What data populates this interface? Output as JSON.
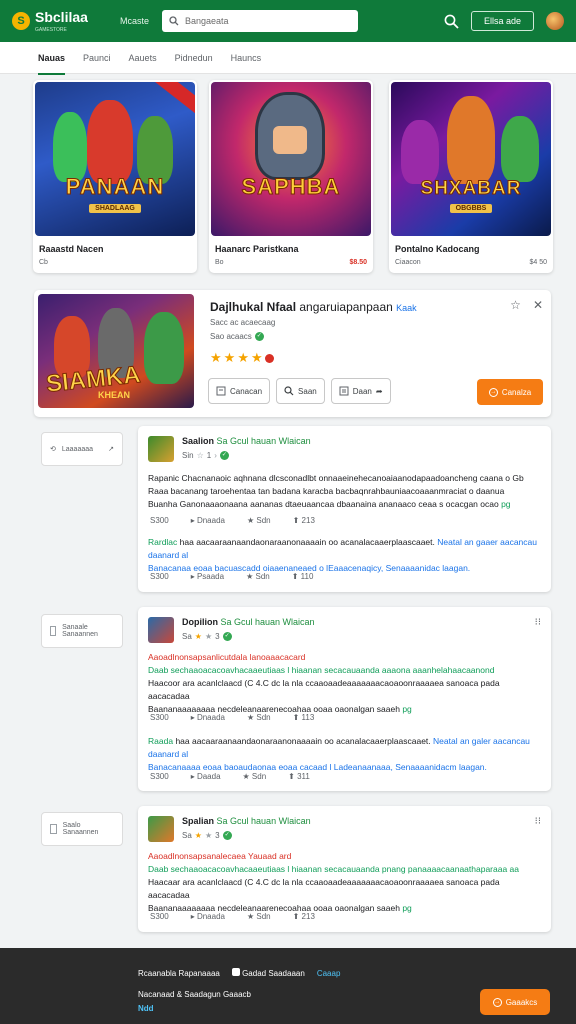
{
  "header": {
    "logo_text": "Sbclilaa",
    "logo_sub": "GAMESTORE",
    "nav_link": "Mcaste",
    "search_placeholder": "Bangaeata",
    "signin_label": "Ellsa ade"
  },
  "tabs": [
    {
      "label": "Nauas",
      "active": true
    },
    {
      "label": "Paunci"
    },
    {
      "label": "Aauets"
    },
    {
      "label": "Pidnedun"
    },
    {
      "label": "Hauncs"
    }
  ],
  "cards": [
    {
      "art_title": "PANAAN",
      "art_sub": "SHADLAAG",
      "name": "Raaastd Nacen",
      "meta_left": "Cb",
      "meta_right": ""
    },
    {
      "art_title": "SAPHBA",
      "art_sub": "",
      "name": "Haanarc Paristkana",
      "meta_left": "Bo",
      "meta_right": "$8.50"
    },
    {
      "art_title": "SHXABAR",
      "art_sub": "OBGBBS",
      "name": "Pontalno Kadocang",
      "meta_left": "Ciaacon",
      "meta_right": "$4 50"
    }
  ],
  "detail": {
    "art_title": "SIAMKA",
    "art_sub": "KHEAN",
    "title": "Dajlhukal Nfaal",
    "title_rest": "angaruiapanpaan",
    "tag": "Kaak",
    "sub1": "Sacc ac acaecaag",
    "sub2": "Sao acaacs",
    "rating": 4,
    "btn1": "Canacan",
    "btn2": "Saan",
    "btn3": "Daan",
    "install_label": "Canalza"
  },
  "side_chips": [
    {
      "label": "Laaaaaaa"
    },
    {
      "label": "Sanaale Sanaannen"
    },
    {
      "label": "Saalo Sanaannen"
    }
  ],
  "reviews": [
    {
      "name": "Saalion",
      "name_sub": "Sa Gcul hauan Wlaican",
      "rating_label": "Sin",
      "rating_count": "1",
      "body": [
        "Rapanic Chacnanaoic aqhnana dlcsconadlbt onnaaeinehecanoaiaanodapaadoancheng caana o Gb",
        "Raaa bacanang taroehentaa tan badana karacba bacbaqnrahbauniaacoaaanmraciat o daanua",
        "Buanha Ganonaaaonaana aananas dtaeuaancaa dbaanaina ananaaco ceaa s ocacgan ocao"
      ],
      "body_tail": "pg",
      "foot": {
        "a": "S300",
        "b": "Dnaada",
        "c": "Sdn",
        "d": "213"
      },
      "reply_1a": "Rardlac",
      "reply_1b": "haa aacaaraanaandaonaraanonaaaain oo acanalacaaerplaascaaet.",
      "reply_1c": "Neatal an gaaer aacancau daanard al",
      "reply_2": "Banacanaa eoaa bacuascadd oiaaenaneaed o lEaaacenaqicy, Senaaaanidac laagan.",
      "foot2": {
        "a": "S300",
        "b": "Psaada",
        "c": "Sdn",
        "d": "110"
      }
    },
    {
      "name": "Dopilion",
      "name_sub": "Sa Gcul hauan Wlaican",
      "rating_label": "Sa",
      "rating_count": "3",
      "body": [
        "Aaoadlnonsapsanlicutdala lanoaaacacard",
        "Daab sechaaoacacoavhacaaeutiaas l hiaanan secacauaanda aaaona aaanhelahaacaanond",
        "Haacoor ara acanlclaacd (C 4.C dc la nla ccaaoaadeaaaaaaacaoaoonraaaaea sanoaca pada aacacadaa",
        "Baananaaaaaaaa necdeleanaarenecoahaa ooaa oaonalgan saaeh"
      ],
      "body_tail": "pg",
      "foot": {
        "a": "S300",
        "b": "Dnaada",
        "c": "Sdn",
        "d": "113"
      },
      "reply_1a": "Raada",
      "reply_1b": "haa aacaaraanaandaonaraanonaaaain oo acanalacaaerplaascaaet.",
      "reply_1c": "Neatal an galer aacancau daanard al",
      "reply_2": "Banacanaaaa eoaa baoaudaonaa eoaa cacaad l Ladeanaanaaa, Senaaaanidacm laagan.",
      "foot2": {
        "a": "S300",
        "b": "Daada",
        "c": "Sdn",
        "d": "311"
      }
    },
    {
      "name": "Spalian",
      "name_sub": "Sa Gcul hauan Wlaican",
      "rating_label": "Sa",
      "rating_count": "3",
      "body": [
        "Aaoadlnonsapsanalecaea Yauaad ard",
        "Daab sechaaoacacoavhacaaeutiaas l hiaanan secacauaanda pnang panaaaacaanaathaparaaa aa",
        "Haacaar ara acanlclaacd (C 4.C dc la nla ccaaoaadeaaaaaaacaoaoonraaaaea sanoaca pada aacacadaa",
        "Baananaaaaaaaa necdeleanaarenecoahaa ooaa oaonalgan saaeh"
      ],
      "body_tail": "pg",
      "foot": {
        "a": "S300",
        "b": "Dnaada",
        "c": "Sdn",
        "d": "213"
      }
    }
  ],
  "footer": {
    "link1": "Rcaanabla Rapanaaaa",
    "link2": "Gadad Saadaaan",
    "link3": "Caaap",
    "line2": "Nacanaad & Saadagun Gaaacb",
    "line3": "Ndd",
    "button_label": "Gaaakcs"
  },
  "colors": {
    "brand_green": "#0f7a3a",
    "install_orange": "#f57c14",
    "star": "#f5a300",
    "link_blue": "#1a73e8"
  }
}
